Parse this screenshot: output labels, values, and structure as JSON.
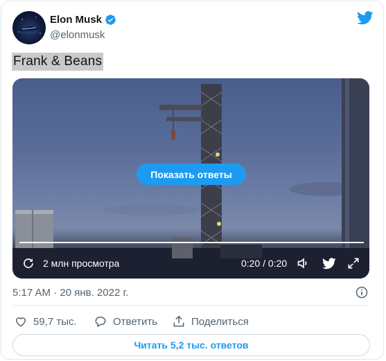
{
  "user": {
    "name": "Elon Musk",
    "handle": "@elonmusk"
  },
  "tweet": {
    "text": "Frank & Beans",
    "timestamp": "5:17 AM · 20 янв. 2022 г."
  },
  "video": {
    "show_replies_label": "Показать ответы",
    "views": "2 млн просмотра",
    "time": "0:20 / 0:20",
    "progress": 1.0
  },
  "actions": {
    "likes": "59,7 тыс.",
    "reply_label": "Ответить",
    "share_label": "Поделиться"
  },
  "read_replies_label": "Читать 5,2 тыс. ответов",
  "colors": {
    "accent": "#1d9bf0",
    "text": "#0f1419",
    "muted": "#536471",
    "border": "#e1e8ed"
  }
}
